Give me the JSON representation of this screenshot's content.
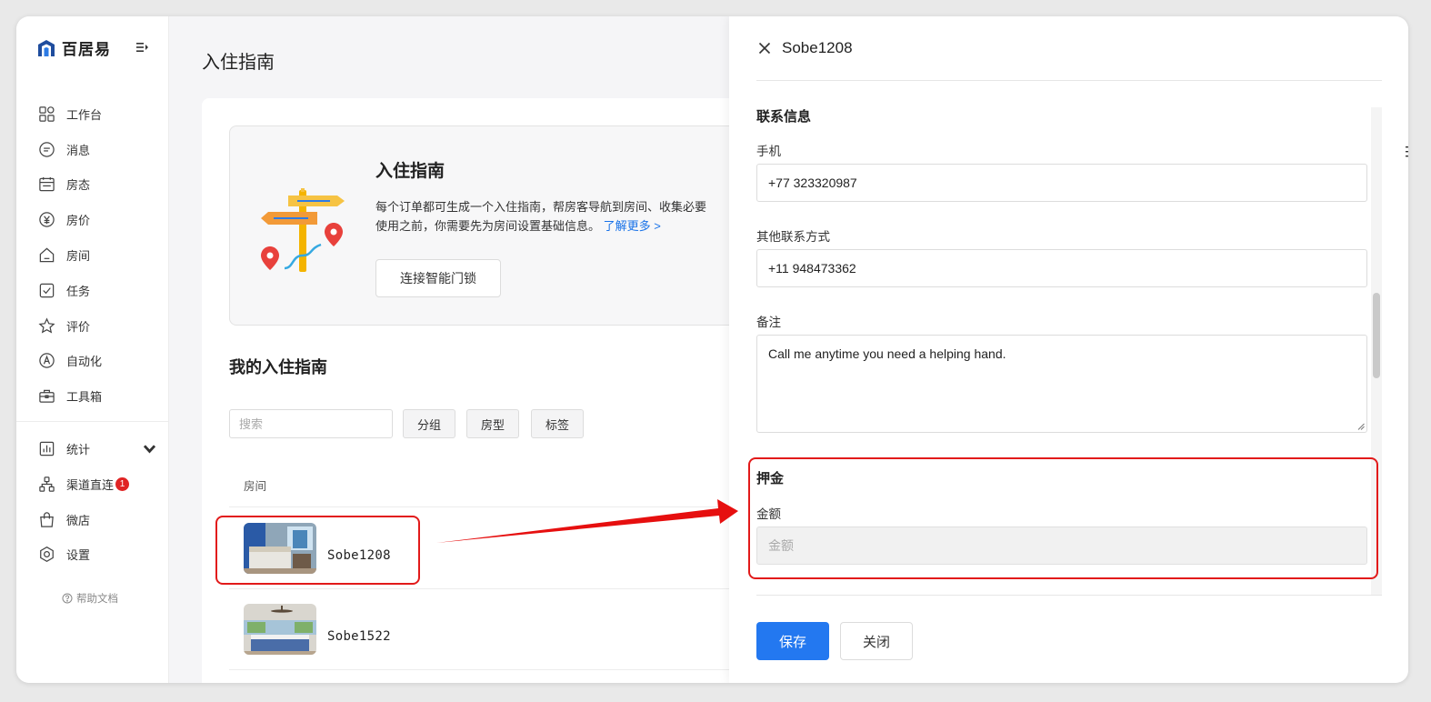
{
  "sidebar": {
    "logo_text": "百居易",
    "items": [
      {
        "label": "工作台",
        "icon": "dashboard-icon"
      },
      {
        "label": "消息",
        "icon": "message-icon"
      },
      {
        "label": "房态",
        "icon": "calendar-icon"
      },
      {
        "label": "房价",
        "icon": "yen-icon"
      },
      {
        "label": "房间",
        "icon": "home-icon"
      },
      {
        "label": "任务",
        "icon": "checkbox-icon"
      },
      {
        "label": "评价",
        "icon": "star-icon"
      },
      {
        "label": "自动化",
        "icon": "automation-icon"
      },
      {
        "label": "工具箱",
        "icon": "toolbox-icon"
      }
    ],
    "items2": [
      {
        "label": "统计",
        "icon": "chart-icon"
      },
      {
        "label": "渠道直连",
        "icon": "channel-icon",
        "badge": "1"
      },
      {
        "label": "微店",
        "icon": "shop-icon"
      },
      {
        "label": "设置",
        "icon": "settings-icon"
      }
    ],
    "help": "帮助文档"
  },
  "main": {
    "title": "入住指南",
    "intro": {
      "title": "入住指南",
      "line1": "每个订单都可生成一个入住指南，帮房客导航到房间、收集必要",
      "line2": "使用之前，你需要先为房间设置基础信息。",
      "link": "了解更多 >",
      "button": "连接智能门锁"
    },
    "my_title": "我的入住指南",
    "search_placeholder": "搜索",
    "filters": [
      "分组",
      "房型",
      "标签"
    ],
    "column_room": "房间",
    "rooms": [
      {
        "name": "Sobe1208"
      },
      {
        "name": "Sobe1522"
      }
    ]
  },
  "drawer": {
    "title": "Sobe1208",
    "contact_section": "联系信息",
    "phone_label": "手机",
    "phone_value": "+77 323320987",
    "other_label": "其他联系方式",
    "other_value": "+11 948473362",
    "note_label": "备注",
    "note_value": "Call me anytime you need a helping hand.",
    "deposit_section": "押金",
    "amount_label": "金额",
    "amount_placeholder": "金额",
    "save": "保存",
    "close": "关闭"
  },
  "colors": {
    "primary": "#2378f0",
    "highlight": "#e21a1a",
    "link": "#1a73e8"
  }
}
